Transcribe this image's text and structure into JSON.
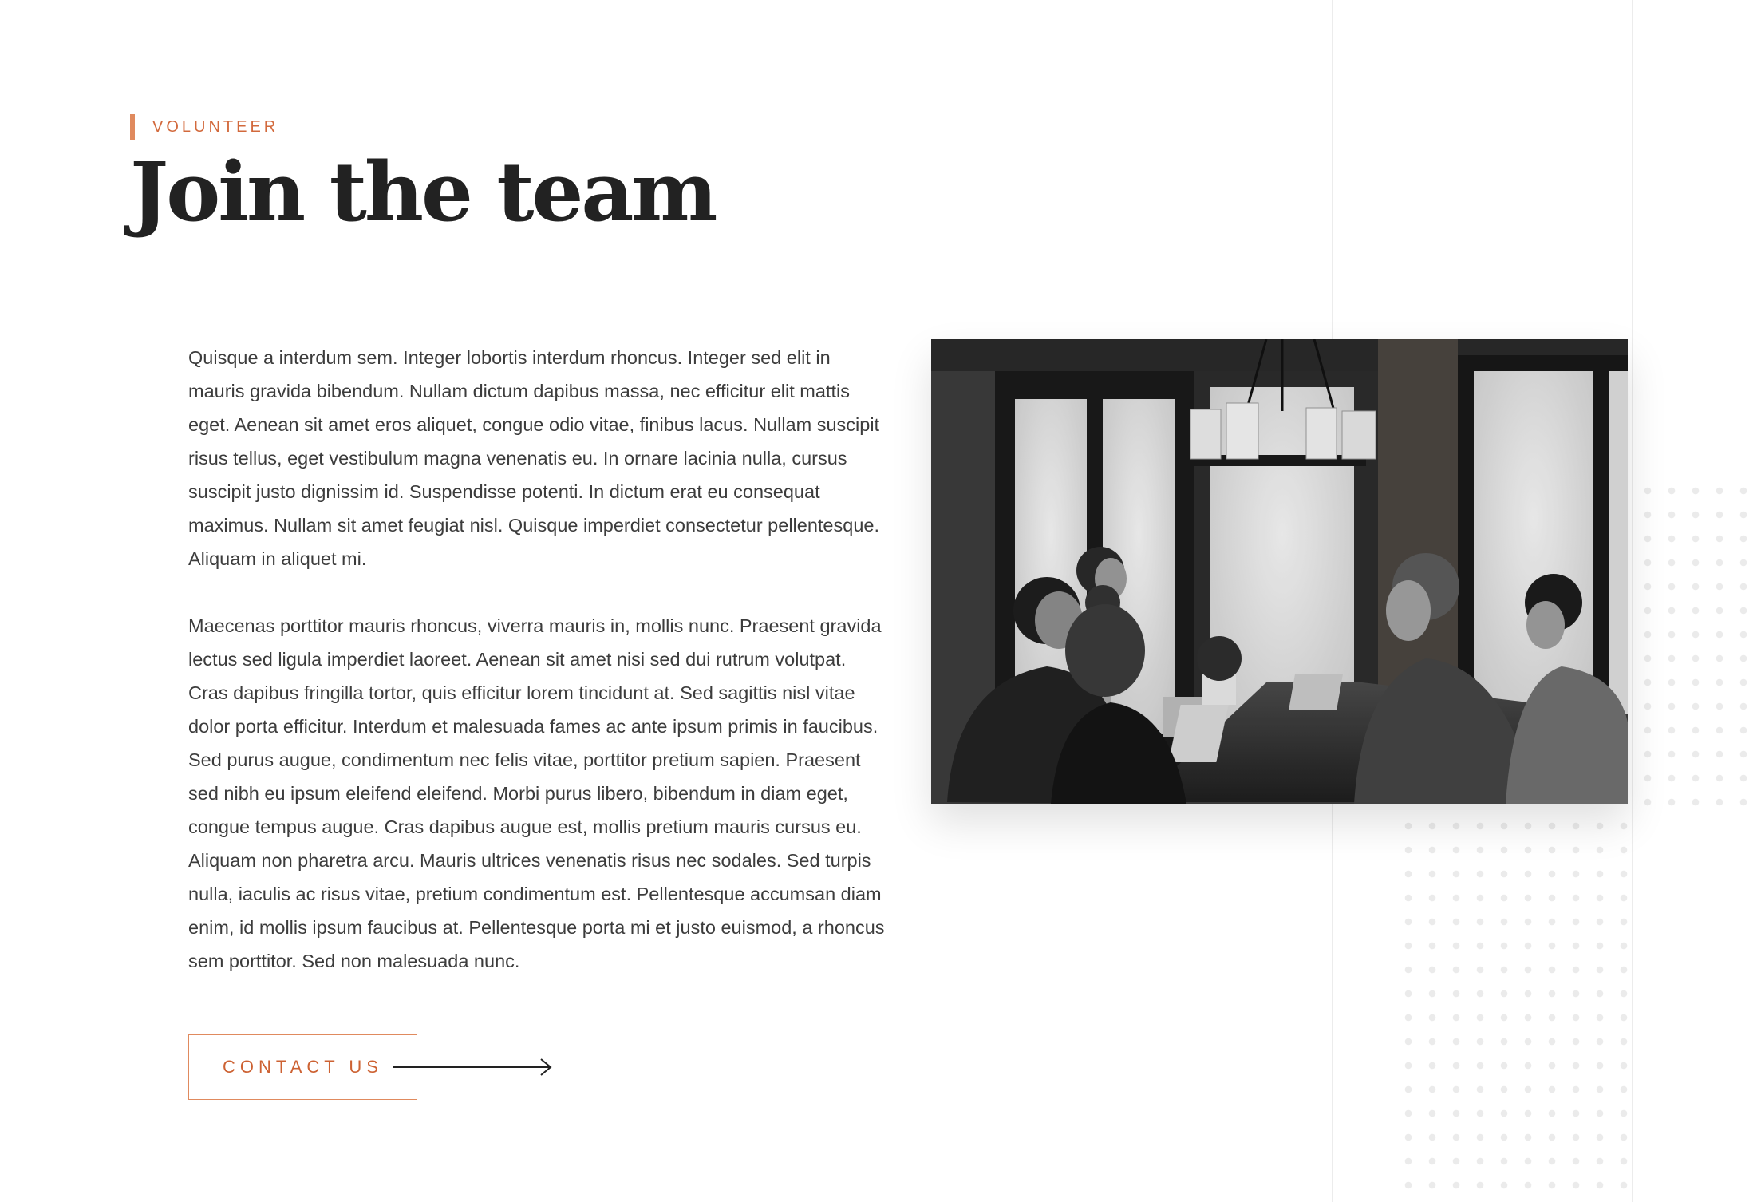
{
  "section": {
    "eyebrow": "Volunteer",
    "title": "Join the team"
  },
  "content": {
    "paragraphs": [
      "Quisque a interdum sem. Integer lobortis interdum rhoncus. Integer sed elit in mauris gravida bibendum. Nullam dictum dapibus massa, nec efficitur elit mattis eget. Aenean sit amet eros aliquet, congue odio vitae, finibus lacus. Nullam suscipit risus tellus, eget vestibulum magna venenatis eu. In ornare lacinia nulla, cursus suscipit justo dignissim id. Suspendisse potenti. In dictum erat eu consequat maximus. Nullam sit amet feugiat nisl. Quisque imperdiet consectetur pellentesque. Aliquam in aliquet mi.",
      "Maecenas porttitor mauris rhoncus, viverra mauris in, mollis nunc. Praesent gravida lectus sed ligula imperdiet laoreet. Aenean sit amet nisi sed dui rutrum volutpat. Cras dapibus fringilla tortor, quis efficitur lorem tincidunt at. Sed sagittis nisl vitae dolor porta efficitur. Interdum et malesuada fames ac ante ipsum primis in faucibus. Sed purus augue, condimentum nec felis vitae, porttitor pretium sapien. Praesent sed nibh eu ipsum eleifend eleifend. Morbi purus libero, bibendum in diam eget, congue tempus augue. Cras dapibus augue est, mollis pretium mauris cursus eu. Aliquam non pharetra arcu. Mauris ultrices venenatis risus nec sodales. Sed turpis nulla, iaculis ac risus vitae, pretium condimentum est. Pellentesque accumsan diam enim, id mollis ipsum faucibus at. Pellentesque porta mi et justo euismod, a rhoncus sem porttitor. Sed non malesuada nunc."
    ]
  },
  "cta": {
    "label": "Contact us",
    "icon": "arrow-right-icon"
  },
  "image": {
    "icon": "team-photo",
    "style": "grayscale"
  },
  "colors": {
    "accent": "#e08a5e",
    "accent_text": "#cd6233",
    "heading": "#222222",
    "body": "#3c3c3c",
    "grid_line": "#ececec",
    "dots": "#ebebeb"
  }
}
